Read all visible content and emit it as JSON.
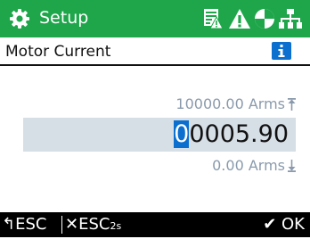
{
  "titlebar": {
    "icon": "gear-icon",
    "title": "Setup",
    "status_icons": [
      "table-warning-icon",
      "warning-icon",
      "status-circle-icon",
      "network-tree-icon"
    ]
  },
  "subheader": {
    "title": "Motor Current",
    "info_icon": "info-icon"
  },
  "editor": {
    "max_limit": "10000.00 Arms",
    "min_limit": "0.00 Arms",
    "value_cursor_digit": "0",
    "value_rest": "0005.90"
  },
  "softkeys": {
    "back_glyph": "↰",
    "esc_label": "ESC",
    "cancel_glyph": "✕",
    "esc_long_label": "ESC",
    "esc_long_sub": "2s",
    "ok_glyph": "✔",
    "ok_label": "OK"
  },
  "colors": {
    "titlebar": "#1fa64b",
    "value_field": "#d6dee6",
    "cursor": "#0b6fcf",
    "info": "#0b6fcf",
    "limit_text": "#8a9aac",
    "softkey_bar": "#000000"
  }
}
